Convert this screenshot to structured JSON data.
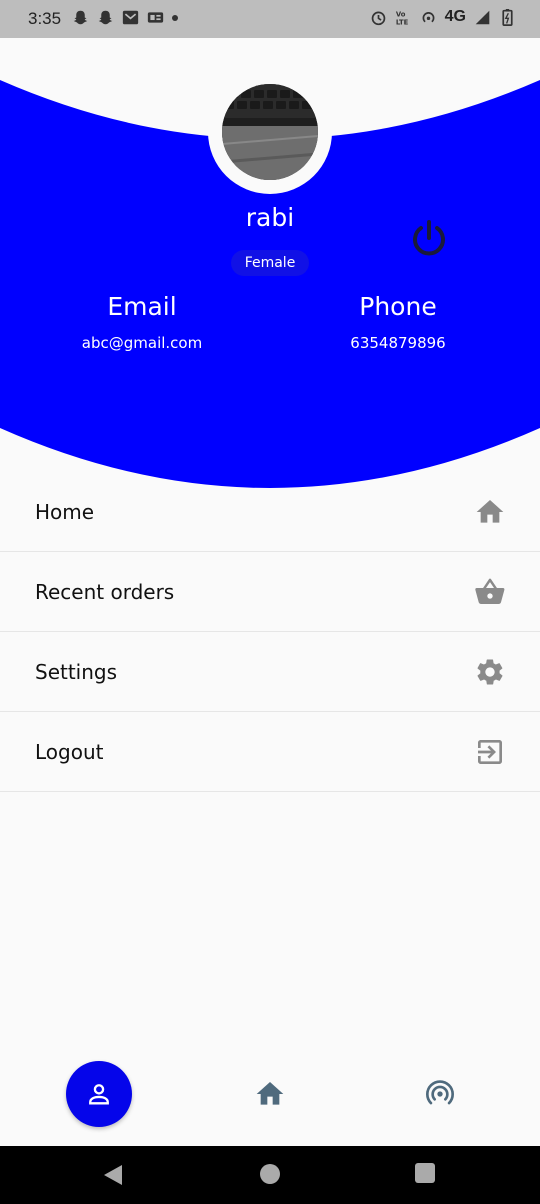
{
  "status_bar": {
    "time": "3:35",
    "network": "4G",
    "icons": [
      "snapchat-icon",
      "snapchat-icon",
      "gmail-icon",
      "news-icon",
      "dot-icon",
      "alarm-icon",
      "volte-icon",
      "hotspot-icon",
      "signal-icon",
      "battery-icon"
    ]
  },
  "profile": {
    "name": "rabi",
    "gender": "Female",
    "email_label": "Email",
    "email": "abc@gmail.com",
    "phone_label": "Phone",
    "phone": "6354879896"
  },
  "menu": [
    {
      "label": "Home",
      "icon": "home-icon"
    },
    {
      "label": "Recent orders",
      "icon": "basket-icon"
    },
    {
      "label": "Settings",
      "icon": "gear-icon"
    },
    {
      "label": "Logout",
      "icon": "exit-icon"
    }
  ],
  "bottom_nav": {
    "items": [
      "person-icon",
      "home-icon",
      "radar-icon"
    ],
    "active": "person-icon"
  },
  "colors": {
    "primary": "#0000ff",
    "nav_active": "#0505ea",
    "menu_icon": "#8a8a8a",
    "nav_icon": "#4f6a7d"
  }
}
